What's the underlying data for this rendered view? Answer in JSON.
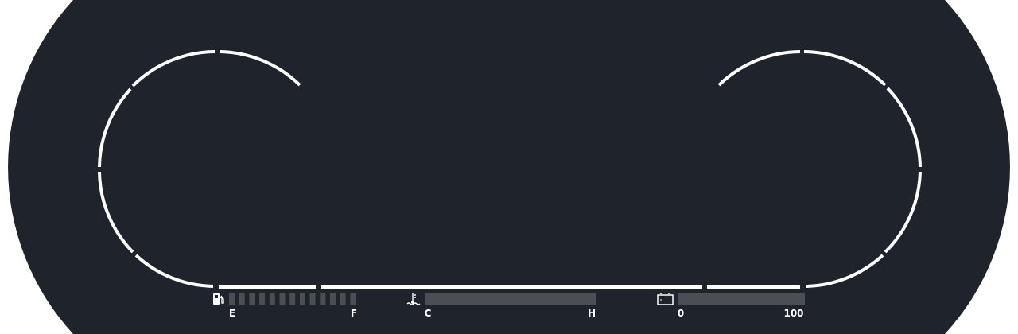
{
  "colors": {
    "panel": "#1f242c",
    "frame": "#ffffff",
    "gauge_track": "#4a4e55",
    "label": "#ffffff"
  },
  "icons": {
    "fuel": "fuel-pump-icon",
    "temperature": "coolant-temperature-icon",
    "battery": "battery-icon"
  },
  "fuel": {
    "min_label": "E",
    "max_label": "F",
    "segments_total": 13,
    "level": 0
  },
  "temperature": {
    "min_label": "C",
    "max_label": "H",
    "level": 0
  },
  "battery": {
    "min_label": "0",
    "max_label": "100",
    "level": 0
  }
}
